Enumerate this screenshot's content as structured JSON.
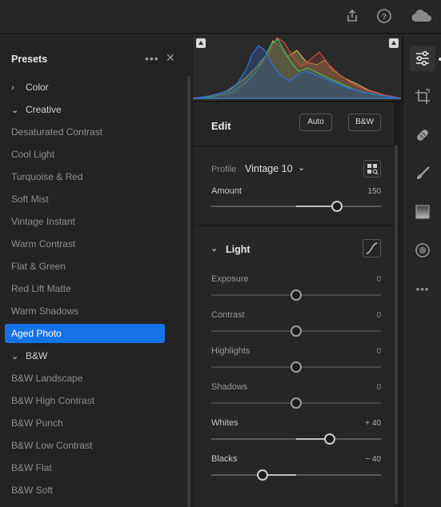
{
  "topbar": {
    "icons": [
      "share-icon",
      "help-icon",
      "cloud-icon"
    ]
  },
  "presets": {
    "title": "Presets",
    "more_icon": "more-icon",
    "close_icon": "close-icon",
    "items": [
      {
        "label": "Color",
        "kind": "group",
        "chevron": "›"
      },
      {
        "label": "Creative",
        "kind": "group",
        "chevron": "⌄"
      },
      {
        "label": "Desaturated Contrast",
        "kind": "preset"
      },
      {
        "label": "Cool Light",
        "kind": "preset"
      },
      {
        "label": "Turquoise & Red",
        "kind": "preset"
      },
      {
        "label": "Soft Mist",
        "kind": "preset"
      },
      {
        "label": "Vintage Instant",
        "kind": "preset"
      },
      {
        "label": "Warm Contrast",
        "kind": "preset"
      },
      {
        "label": "Flat & Green",
        "kind": "preset"
      },
      {
        "label": "Red Lift Matte",
        "kind": "preset"
      },
      {
        "label": "Warm Shadows",
        "kind": "preset"
      },
      {
        "label": "Aged Photo",
        "kind": "preset",
        "selected": true
      },
      {
        "label": "B&W",
        "kind": "group",
        "chevron": "⌄"
      },
      {
        "label": "B&W Landscape",
        "kind": "preset"
      },
      {
        "label": "B&W High Contrast",
        "kind": "preset"
      },
      {
        "label": "B&W Punch",
        "kind": "preset"
      },
      {
        "label": "B&W Low Contrast",
        "kind": "preset"
      },
      {
        "label": "B&W Flat",
        "kind": "preset"
      },
      {
        "label": "B&W Soft",
        "kind": "preset"
      }
    ]
  },
  "edit": {
    "title": "Edit",
    "auto_label": "Auto",
    "bw_label": "B&W",
    "profile_label": "Profile",
    "profile_value": "Vintage 10",
    "amount_label": "Amount",
    "amount_value": "150",
    "amount_fraction": 0.74
  },
  "light": {
    "title": "Light",
    "sliders": [
      {
        "label": "Exposure",
        "value": "0",
        "fraction": 0.5,
        "active": false
      },
      {
        "label": "Contrast",
        "value": "0",
        "fraction": 0.5,
        "active": false
      },
      {
        "label": "Highlights",
        "value": "0",
        "fraction": 0.5,
        "active": false
      },
      {
        "label": "Shadows",
        "value": "0",
        "fraction": 0.5,
        "active": false
      },
      {
        "label": "Whites",
        "value": "+ 40",
        "fraction": 0.7,
        "active": true
      },
      {
        "label": "Blacks",
        "value": "− 40",
        "fraction": 0.3,
        "active": true
      }
    ]
  },
  "tools": [
    "adjust-icon",
    "crop-icon",
    "healing-icon",
    "brush-icon",
    "gradient-icon",
    "radial-icon",
    "more-tools-icon"
  ],
  "colors": {
    "accent": "#1473e6",
    "hist_blue": "#2f6fd8",
    "hist_green": "#3fbf5f",
    "hist_red": "#d8443f",
    "hist_yellow": "#c9b347"
  }
}
